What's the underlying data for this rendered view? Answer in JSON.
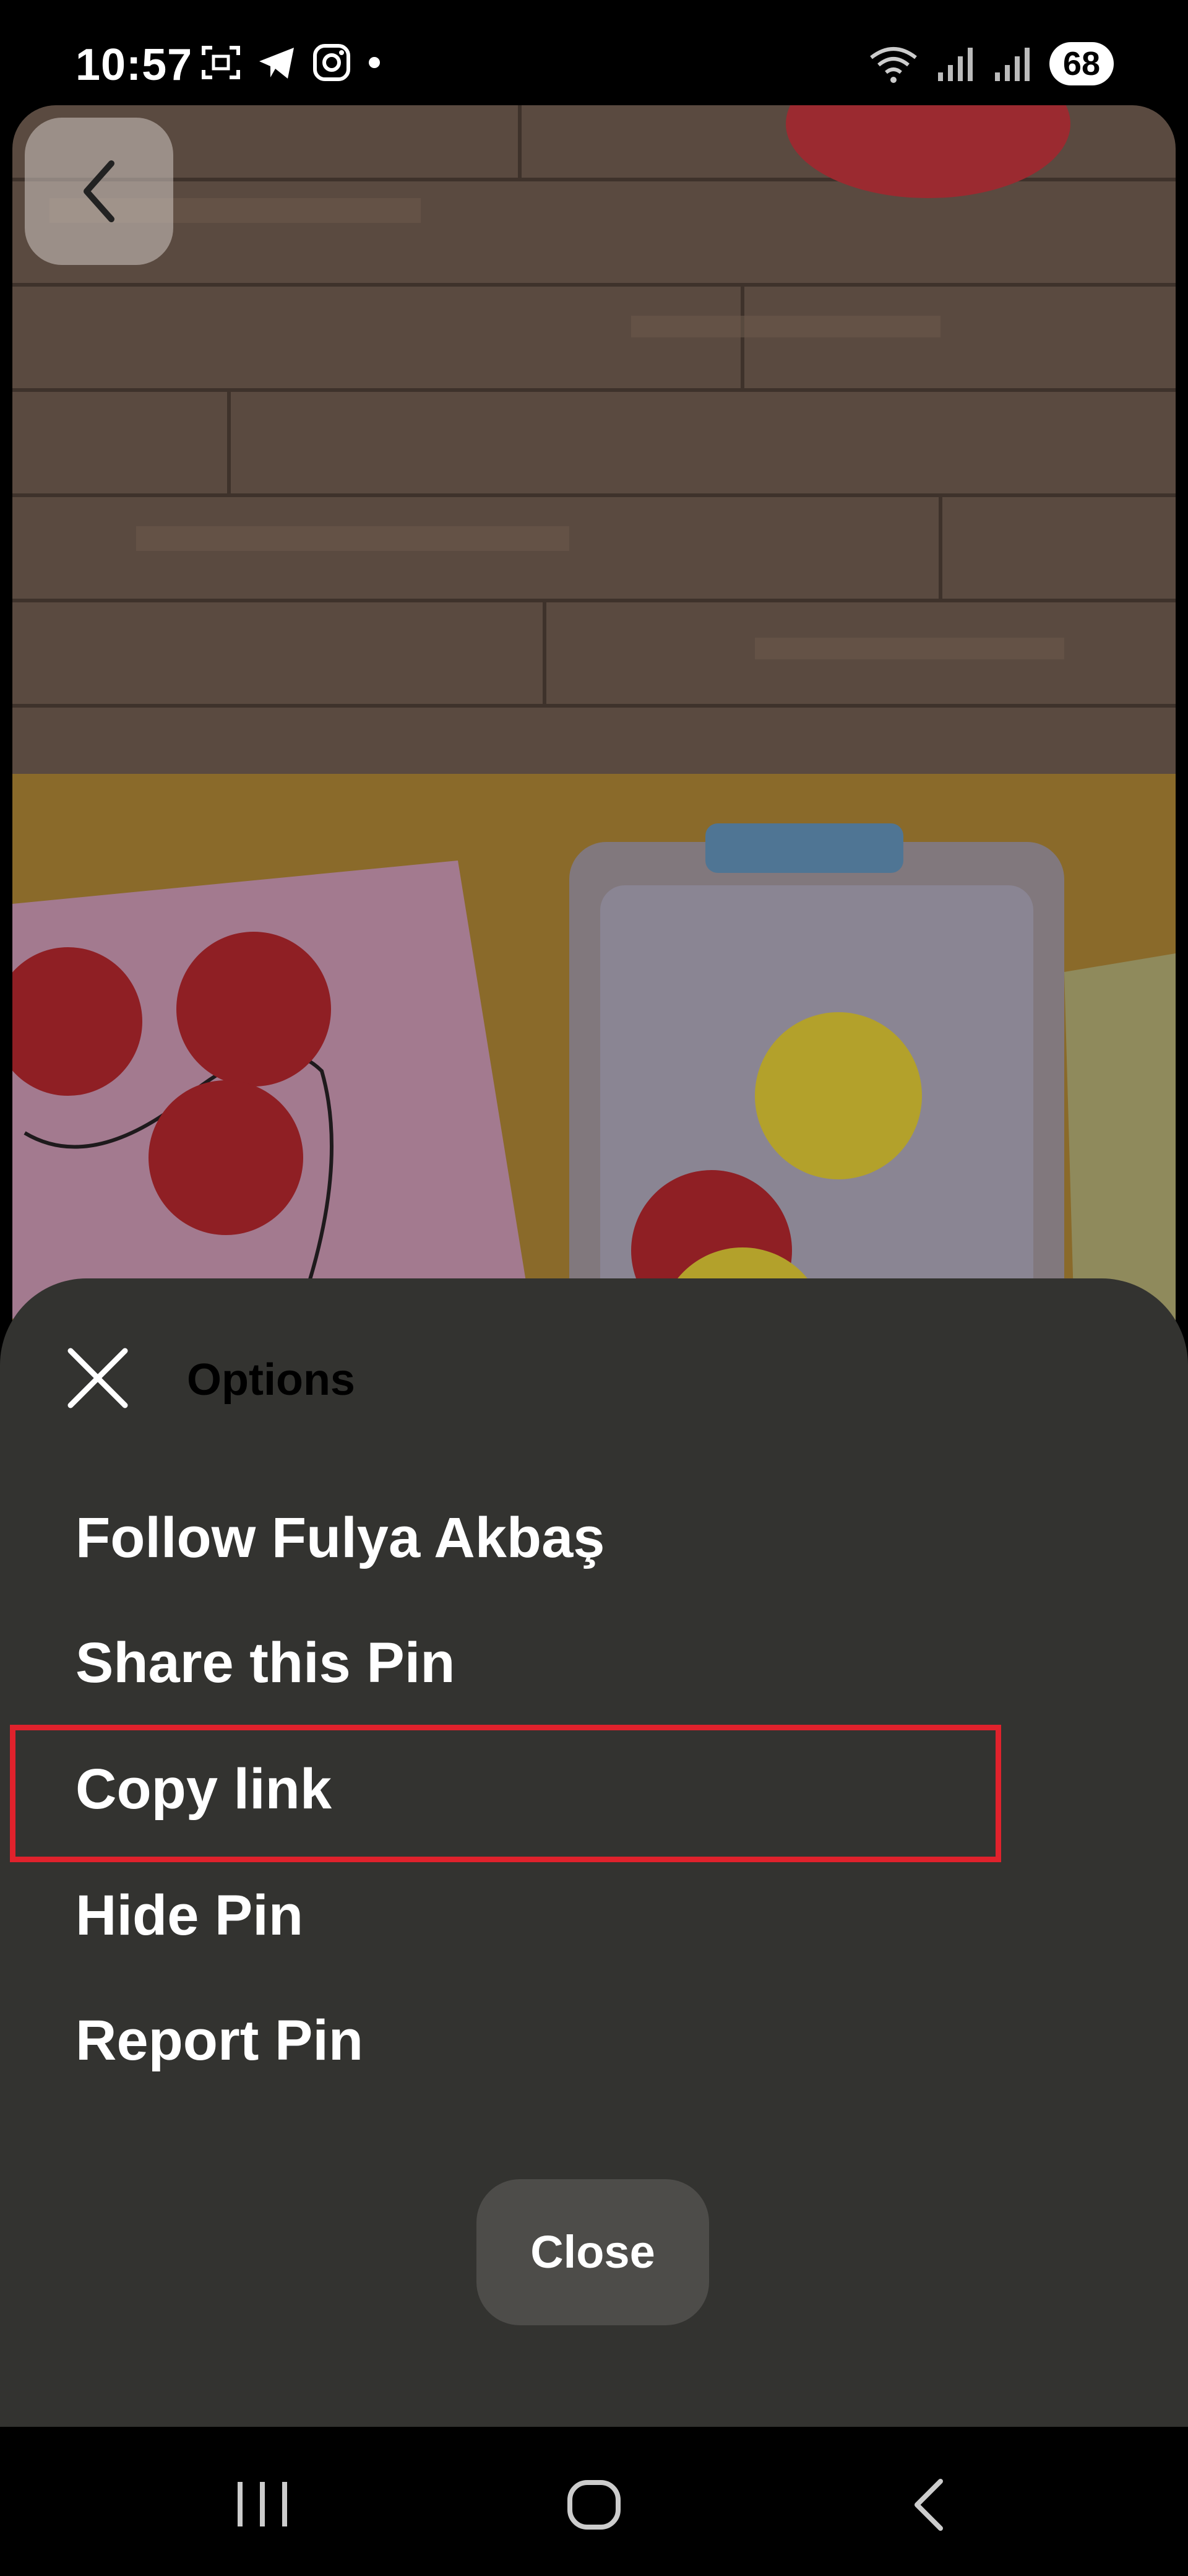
{
  "status_bar": {
    "time": "10:57",
    "battery": "68",
    "left_icons": [
      "screenshot-icon",
      "telegram-icon",
      "instagram-icon",
      "notification-dot-icon"
    ],
    "right_icons": [
      "wifi-icon",
      "signal-icon",
      "signal-icon"
    ]
  },
  "background": {
    "description_icons": [
      "back-arrow-icon"
    ]
  },
  "sheet": {
    "title": "Options",
    "items": [
      {
        "label": "Follow Fulya Akbaş"
      },
      {
        "label": "Share this Pin"
      },
      {
        "label": "Copy link"
      },
      {
        "label": "Hide Pin"
      },
      {
        "label": "Report Pin"
      }
    ],
    "close_label": "Close"
  },
  "colors": {
    "sheet_bg": "#333330",
    "highlight": "#e0222c",
    "close_button_bg": "#4d4c49"
  }
}
